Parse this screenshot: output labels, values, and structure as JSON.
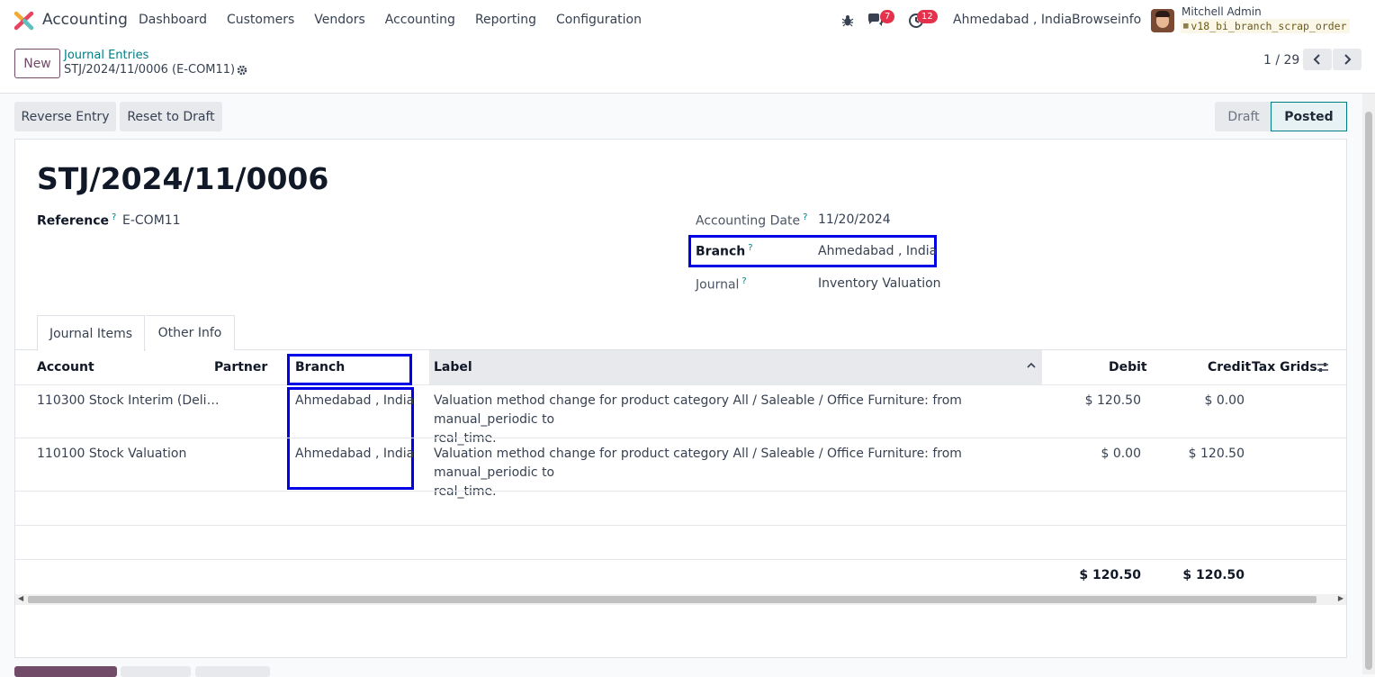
{
  "navbar": {
    "app_name": "Accounting",
    "menu": [
      "Dashboard",
      "Customers",
      "Vendors",
      "Accounting",
      "Reporting",
      "Configuration"
    ],
    "messages_count": "7",
    "activities_count": "12",
    "branch": "Ahmedabad , India",
    "company": "Browseinfo",
    "user_name": "Mitchell Admin",
    "database": "v18_bi_branch_scrap_order"
  },
  "control_panel": {
    "new_label": "New",
    "breadcrumb_parent": "Journal Entries",
    "breadcrumb_current": "STJ/2024/11/0006 (E-COM11)",
    "pager": "1 / 29"
  },
  "statusbar": {
    "reverse_label": "Reverse Entry",
    "reset_label": "Reset to Draft",
    "stage_draft": "Draft",
    "stage_posted": "Posted"
  },
  "form": {
    "title": "STJ/2024/11/0006",
    "reference_label": "Reference",
    "reference_value": "E-COM11",
    "accounting_date_label": "Accounting Date",
    "accounting_date_value": "11/20/2024",
    "branch_label": "Branch",
    "branch_value": "Ahmedabad , India",
    "journal_label": "Journal",
    "journal_value": "Inventory Valuation",
    "help_mark": "?"
  },
  "tabs": [
    "Journal Items",
    "Other Info"
  ],
  "table": {
    "headers": {
      "account": "Account",
      "partner": "Partner",
      "branch": "Branch",
      "label": "Label",
      "debit": "Debit",
      "credit": "Credit",
      "tax_grids": "Tax Grids"
    },
    "rows": [
      {
        "account": "110300 Stock Interim (Deli…",
        "partner": "",
        "branch": "Ahmedabad , India",
        "label_line1": "Valuation method change for product category All / Saleable / Office Furniture: from manual_periodic to",
        "label_line2": "real_time.",
        "debit": "$ 120.50",
        "credit": "$ 0.00"
      },
      {
        "account": "110100 Stock Valuation",
        "partner": "",
        "branch": "Ahmedabad , India",
        "label_line1": "Valuation method change for product category All / Saleable / Office Furniture: from manual_periodic to",
        "label_line2": "real_time.",
        "debit": "$ 0.00",
        "credit": "$ 120.50"
      }
    ],
    "total_debit": "$ 120.50",
    "total_credit": "$ 120.50"
  },
  "colors": {
    "brand": "#714b67",
    "link": "#017e84",
    "highlight": "#0000e6",
    "badge": "#e4324c"
  }
}
